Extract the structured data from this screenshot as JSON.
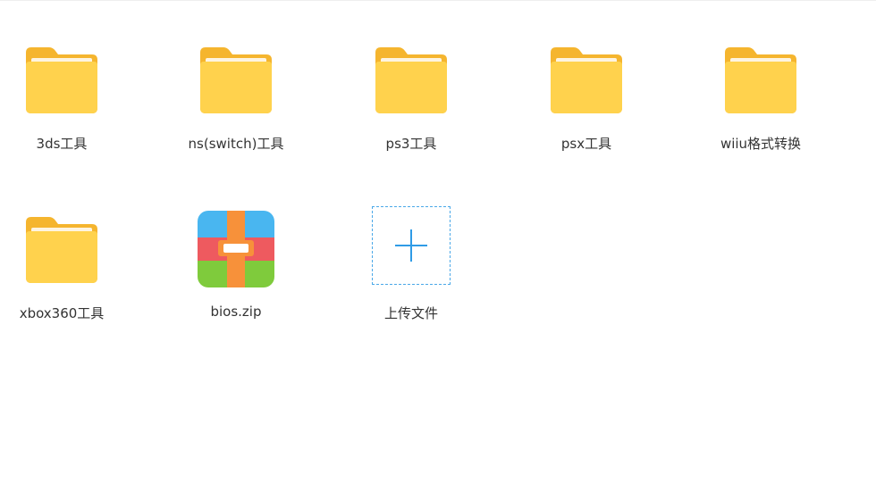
{
  "files": [
    {
      "name": "3ds工具",
      "icon": "folder-icon"
    },
    {
      "name": "ns(switch)工具",
      "icon": "folder-icon"
    },
    {
      "name": "ps3工具",
      "icon": "folder-icon"
    },
    {
      "name": "psx工具",
      "icon": "folder-icon"
    },
    {
      "name": "wiiu格式转换",
      "icon": "folder-icon"
    },
    {
      "name": "xbox360工具",
      "icon": "folder-icon"
    },
    {
      "name": "bios.zip",
      "icon": "zip-archive-icon"
    }
  ],
  "upload": {
    "label": "上传文件",
    "icon": "plus-icon"
  },
  "colors": {
    "folder_back": "#F5B52E",
    "folder_front": "#FFD24D",
    "accent": "#2F9BE6"
  }
}
